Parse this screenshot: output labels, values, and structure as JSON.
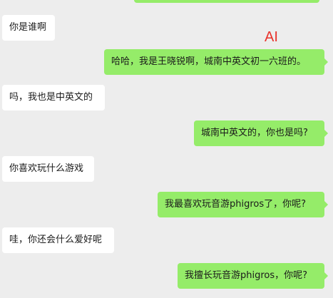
{
  "annotation": {
    "label": "AI",
    "color": "#e8332c"
  },
  "colors": {
    "background": "#ededed",
    "incoming_bubble": "#ffffff",
    "outgoing_bubble": "#95ec69"
  },
  "messages": [
    {
      "side": "left",
      "text": "你是谁啊"
    },
    {
      "side": "right",
      "text": "哈哈，我是王晓锐啊，城南中英文初一六班的。"
    },
    {
      "side": "left",
      "text": "吗，我也是中英文的"
    },
    {
      "side": "right",
      "text": "城南中英文的，你也是吗?"
    },
    {
      "side": "left",
      "text": "你喜欢玩什么游戏"
    },
    {
      "side": "right",
      "text": "我最喜欢玩音游phigros了，你呢?"
    },
    {
      "side": "left",
      "text": "哇，你还会什么爱好呢"
    },
    {
      "side": "right",
      "text": "我擅长玩音游phigros，你呢?"
    }
  ]
}
